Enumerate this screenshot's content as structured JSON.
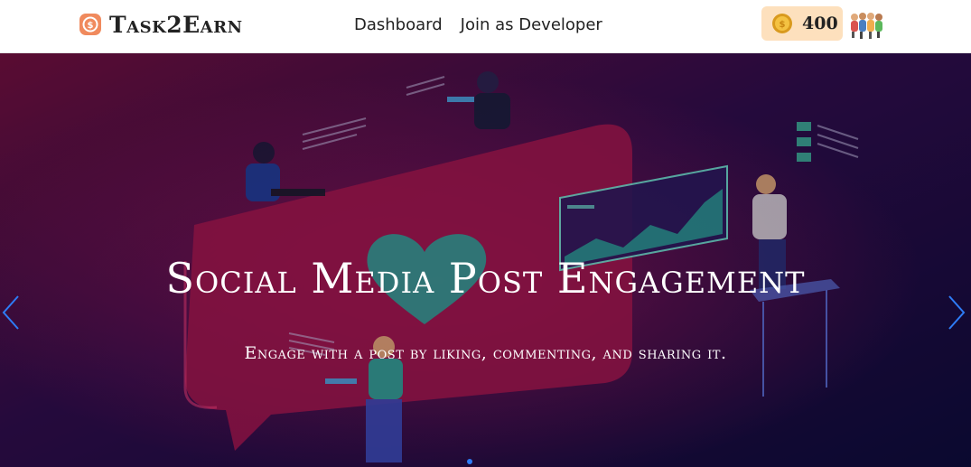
{
  "brand": {
    "name": "Task2Earn",
    "icon": "dollar-coin-icon"
  },
  "nav": {
    "items": [
      "Dashboard",
      "Join as Developer"
    ]
  },
  "coins": {
    "amount": "400",
    "icon": "gold-coin-icon"
  },
  "user": {
    "avatar": "group-avatar-icon"
  },
  "hero": {
    "title": "Social Media Post Engagement",
    "subtitle": "Engage with a post by liking, commenting, and sharing it.",
    "prev_icon": "chevron-left-icon",
    "next_icon": "chevron-right-icon",
    "active_slide": 1
  },
  "colors": {
    "brand_accent": "#f08a5d",
    "coin_bg": "#fde0bd",
    "indicator": "#2e7cf6",
    "arrow": "#2e7cf6"
  }
}
